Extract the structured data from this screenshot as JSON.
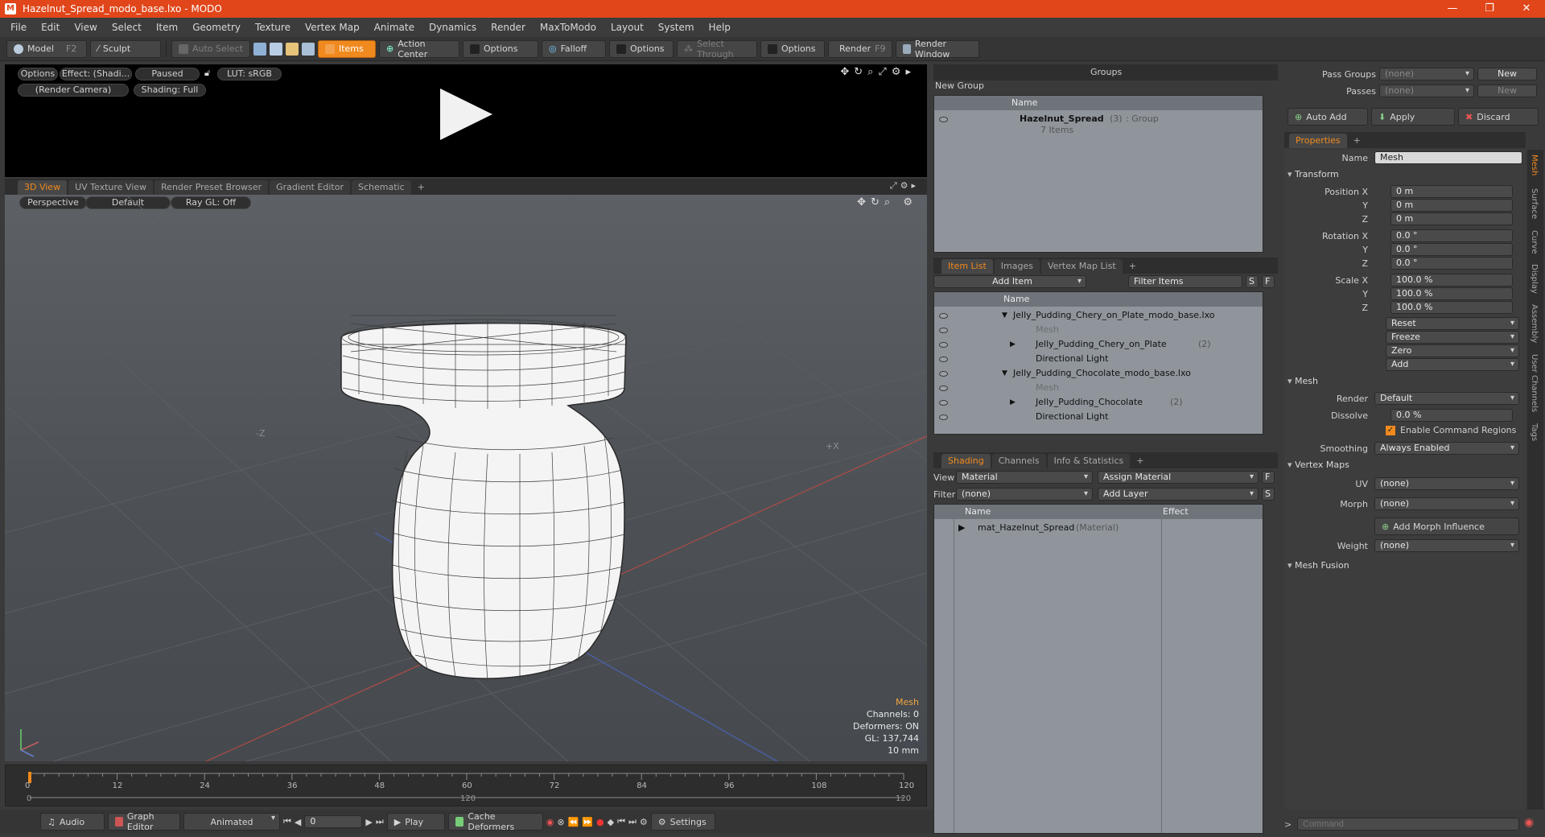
{
  "window": {
    "title": "Hazelnut_Spread_modo_base.lxo - MODO",
    "controls": [
      "—",
      "❐",
      "✕"
    ]
  },
  "menubar": [
    "File",
    "Edit",
    "View",
    "Select",
    "Item",
    "Geometry",
    "Texture",
    "Vertex Map",
    "Animate",
    "Dynamics",
    "Render",
    "MaxToModo",
    "Layout",
    "System",
    "Help"
  ],
  "toolbar": {
    "model": "Model",
    "model_key": "F2",
    "sculpt": "Sculpt",
    "auto_select": "Auto Select",
    "items": "Items",
    "action_center": "Action Center",
    "options1": "Options",
    "falloff": "Falloff",
    "options2": "Options",
    "select_through": "Select Through",
    "options3": "Options",
    "render": "Render",
    "render_key": "F9",
    "render_window": "Render Window"
  },
  "preview": {
    "options": "Options",
    "effect": "Effect: (Shadi...",
    "paused": "Paused",
    "lut": "LUT: sRGB",
    "camera": "(Render Camera)",
    "shading": "Shading: Full"
  },
  "viewtabs": {
    "tabs": [
      "3D View",
      "UV Texture View",
      "Render Preset Browser",
      "Gradient Editor",
      "Schematic"
    ],
    "active": "3D View",
    "add": "+"
  },
  "viewport": {
    "perspective": "Perspective",
    "default": "Default",
    "raygl": "Ray GL: Off",
    "axis_label_x": "+X",
    "axis_label_z": "-Z",
    "info": {
      "title": "Mesh",
      "channels": "Channels: 0",
      "deformers": "Deformers: ON",
      "gl": "GL: 137,744",
      "size": "10 mm"
    }
  },
  "timeline": {
    "ticks": [
      "0",
      "12",
      "24",
      "36",
      "48",
      "60",
      "72",
      "84",
      "96",
      "108",
      "120"
    ],
    "sub_left": "0",
    "sub_mid": "120",
    "sub_right": "120"
  },
  "bottombar": {
    "audio": "Audio",
    "graph_editor": "Graph Editor",
    "animated": "Animated",
    "frame": "0",
    "play": "Play",
    "cache_deformers": "Cache Deformers",
    "settings": "Settings"
  },
  "groups": {
    "title": "Groups",
    "new_group": "New Group",
    "col_name": "Name",
    "item_name": "Hazelnut_Spread",
    "item_count": "(3)",
    "item_type": ": Group",
    "item_sub": "7 Items"
  },
  "itemlist": {
    "tabs": [
      "Item List",
      "Images",
      "Vertex Map List"
    ],
    "add": "+",
    "add_item": "Add Item",
    "filter": "Filter Items",
    "s": "S",
    "f": "F",
    "col_name": "Name",
    "rows": [
      {
        "text": "Jelly_Pudding_Chery_on_Plate_modo_base.lxo",
        "count": "",
        "level": 0,
        "dim": false
      },
      {
        "text": "Mesh",
        "count": "",
        "level": 1,
        "dim": true
      },
      {
        "text": "Jelly_Pudding_Chery_on_Plate",
        "count": "(2)",
        "level": 1,
        "dim": false
      },
      {
        "text": "Directional Light",
        "count": "",
        "level": 1,
        "dim": false
      },
      {
        "text": "Jelly_Pudding_Chocolate_modo_base.lxo",
        "count": "",
        "level": 0,
        "dim": false
      },
      {
        "text": "Mesh",
        "count": "",
        "level": 1,
        "dim": true
      },
      {
        "text": "Jelly_Pudding_Chocolate",
        "count": "(2)",
        "level": 1,
        "dim": false
      },
      {
        "text": "Directional Light",
        "count": "",
        "level": 1,
        "dim": false
      }
    ]
  },
  "shading": {
    "tabs": [
      "Shading",
      "Channels",
      "Info & Statistics"
    ],
    "add": "+",
    "view_label": "View",
    "view_value": "Material",
    "assign_material": "Assign Material",
    "f": "F",
    "filter_label": "Filter",
    "filter_value": "(none)",
    "add_layer": "Add Layer",
    "s": "S",
    "col_name": "Name",
    "col_effect": "Effect",
    "row_name": "mat_Hazelnut_Spread",
    "row_type": "(Material)"
  },
  "passes": {
    "pass_groups_label": "Pass Groups",
    "pass_groups_value": "(none)",
    "new1": "New",
    "passes_label": "Passes",
    "passes_value": "(none)",
    "new2": "New",
    "auto_add": "Auto Add",
    "apply": "Apply",
    "discard": "Discard"
  },
  "properties": {
    "tab": "Properties",
    "add": "+",
    "name_label": "Name",
    "name_value": "Mesh",
    "transform": "Transform",
    "position_label": "Position X",
    "pos": [
      "0 m",
      "0 m",
      "0 m"
    ],
    "rotation_label": "Rotation X",
    "rot": [
      "0.0 °",
      "0.0 °",
      "0.0 °"
    ],
    "scale_label": "Scale X",
    "scl": [
      "100.0 %",
      "100.0 %",
      "100.0 %"
    ],
    "y": "Y",
    "z": "Z",
    "reset": "Reset",
    "freeze": "Freeze",
    "zero": "Zero",
    "addbtn": "Add",
    "mesh": "Mesh",
    "render_label": "Render",
    "render_value": "Default",
    "dissolve_label": "Dissolve",
    "dissolve_value": "0.0 %",
    "enable_command_regions": "Enable Command Regions",
    "smoothing_label": "Smoothing",
    "smoothing_value": "Always Enabled",
    "vertex_maps": "Vertex Maps",
    "uv_label": "UV",
    "uv_value": "(none)",
    "morph_label": "Morph",
    "morph_value": "(none)",
    "add_morph": "Add Morph Influence",
    "weight_label": "Weight",
    "weight_value": "(none)",
    "mesh_fusion": "Mesh Fusion",
    "side_tabs": [
      "Mesh",
      "Surface",
      "Curve",
      "Display",
      "Assembly",
      "User Channels",
      "Tags"
    ]
  },
  "command": {
    "placeholder": "Command",
    "prompt": ">"
  },
  "colors": {
    "accent": "#f08a1e",
    "titlebar": "#e0461a"
  }
}
